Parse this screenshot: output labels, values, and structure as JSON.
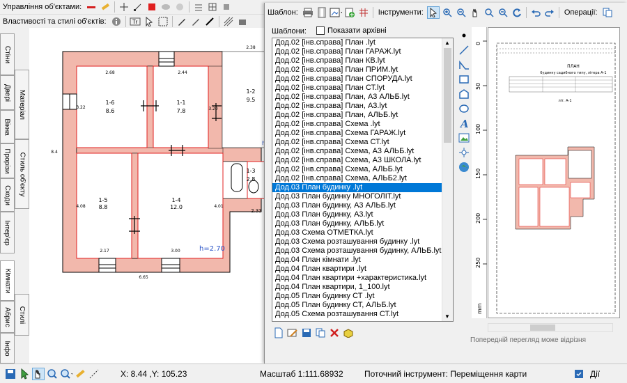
{
  "toolbars": {
    "objects_label": "Управління об'єктами:",
    "props_label": "Властивості та стилі об'єктів:"
  },
  "left_tabs": [
    {
      "label": "Стіни"
    },
    {
      "label": "Матеріал"
    },
    {
      "label": "Двері"
    },
    {
      "label": "Вікна"
    },
    {
      "label": "Прорізи"
    },
    {
      "label": "Сходи"
    },
    {
      "label": "Стиль об'єкту"
    },
    {
      "label": "Інтер'єр"
    },
    {
      "label": "Кімнати"
    },
    {
      "label": "Абрис"
    },
    {
      "label": "Стилі"
    },
    {
      "label": "Інфо"
    }
  ],
  "plan": {
    "overall_width": "6.65",
    "overall_height": "8.4",
    "top_dims": [
      "2.68",
      "2.44",
      "2.38"
    ],
    "rooms": [
      {
        "num": "1-6",
        "area": "8.6",
        "side": "3.22"
      },
      {
        "num": "1-1",
        "area": "7.8",
        "side": "3.20"
      },
      {
        "num": "1-2",
        "area": "9.5"
      },
      {
        "num": "1-3",
        "area": "2.8"
      },
      {
        "num": "1-5",
        "area": "8.8",
        "side": "4.08",
        "bottom": "2.17"
      },
      {
        "num": "1-4",
        "area": "12.0",
        "side": "4.01",
        "bottom": "3.00"
      }
    ],
    "dim_233": "2.33",
    "dim_h": "h=2.70",
    "dim_h2": "h=2"
  },
  "dialog": {
    "templates_label": "Шаблон:",
    "tools_label": "Інструменти:",
    "operations_label": "Операції:",
    "templates_header": "Шаблони:",
    "archive_checkbox": "Показати архівні",
    "selected_index": 17,
    "items": [
      "Дод.02 [інв.справа] План .lyt",
      "Дод.02 [інв.справа] План ГАРАЖ.lyt",
      "Дод.02 [інв.справа] План КВ.lyt",
      "Дод.02 [інв.справа] План ПРИМ.lyt",
      "Дод.02 [інв.справа] План СПОРУДА.lyt",
      "Дод.02 [інв.справа] План СТ.lyt",
      "Дод.02 [інв.справа] План, А3 АЛЬБ.lyt",
      "Дод.02 [інв.справа] План, А3.lyt",
      "Дод.02 [інв.справа] План, АЛЬБ.lyt",
      "Дод.02 [інв.справа] Схема .lyt",
      "Дод.02 [інв.справа] Схема ГАРАЖ.lyt",
      "Дод.02 [інв.справа] Схема СТ.lyt",
      "Дод.02 [інв.справа] Схема, А3 АЛЬБ.lyt",
      "Дод.02 [інв.справа] Схема, А3 ШКОЛА.lyt",
      "Дод.02 [інв.справа] Схема, АЛЬБ.lyt",
      "Дод.02 [інв.справа] Схема, АЛЬБ2.lyt",
      "Дод.03 План будинку .lyt",
      "Дод.03 План будинку МНОГОЛІТ.lyt",
      "Дод.03 План будинку, А3 АЛЬБ.lyt",
      "Дод.03 План будинку, А3.lyt",
      "Дод.03 План будинку, АЛЬБ.lyt",
      "Дод.03 Схема ОТМЕТКА.lyt",
      "Дод.03 Схема розташування будинку .lyt",
      "Дод.03 Схема розташування будинку, АЛЬБ.lyt",
      "Дод.04 План кімнати .lyt",
      "Дод.04 План квартири .lyt",
      "Дод.04 План квартири +характеристика.lyt",
      "Дод.04 План квартири, 1_100.lyt",
      "Дод.05 План будинку СТ .lyt",
      "Дод.05 План будинку СТ, АЛЬБ.lyt",
      "Дод.05 Схема розташування СТ.lyt"
    ],
    "preview_caption": "Попередній перегляд може відрізня",
    "ruler_unit": "mm",
    "ruler_ticks": [
      "0",
      "50",
      "100",
      "150",
      "200",
      "250"
    ],
    "sheet_title": "ПЛАН",
    "sheet_subtitle": "будинку садибного типу, літера А-1",
    "sheet_label": "літ. А-1"
  },
  "status": {
    "coords": "X: 8.44 ,Y: 105.23",
    "scale": "Масштаб 1:111.68932",
    "tool": "Поточний інструмент: Переміщення карти",
    "actions": "Дії"
  },
  "colors": {
    "wall": "#f2b8ac",
    "selection": "#0078d7",
    "frame": "#e02020"
  }
}
